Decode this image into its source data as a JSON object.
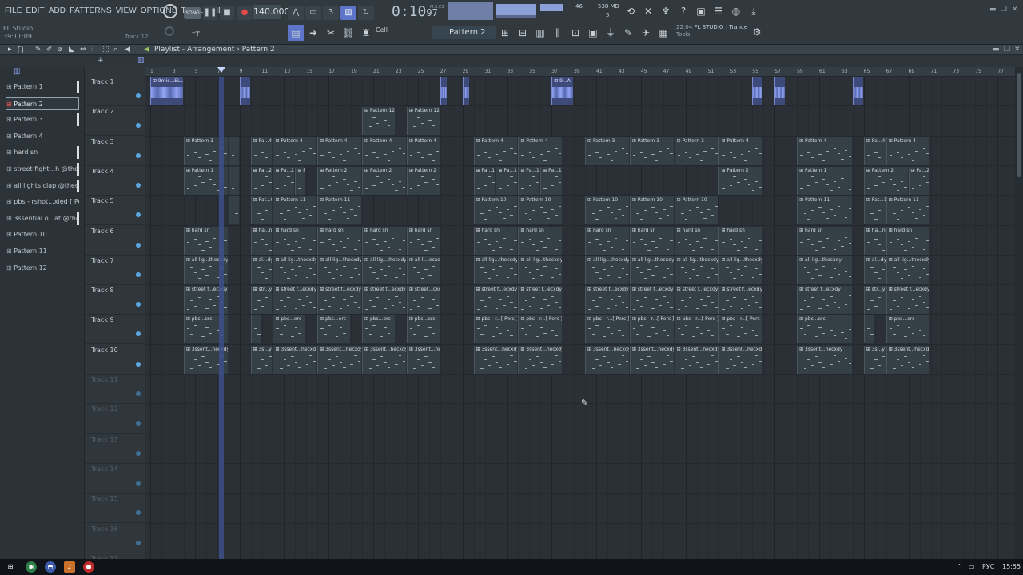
{
  "menu": [
    "FILE",
    "EDIT",
    "ADD",
    "PATTERNS",
    "VIEW",
    "OPTIONS",
    "TOOLS",
    "HELP"
  ],
  "hint": {
    "line1": "FL Studio",
    "line2": "39:11:09"
  },
  "pattern_label": "Track 12",
  "transport": {
    "mode": "SONG",
    "tempo": "140.000",
    "time": "0:10",
    "time_frac": "97",
    "time_unit": "M:S:CS"
  },
  "cpu": {
    "value": "46",
    "memory": "538 MB",
    "voices": "5"
  },
  "toolbar2": {
    "snap": "Cell",
    "pattern": "Pattern 2"
  },
  "news": {
    "time": "22:04",
    "text": "FL STUDIO | Trance",
    "sub": "Tools"
  },
  "playlist": {
    "breadcrumb": "Playlist - Arrangement",
    "sep": "›",
    "current_pattern": "Pattern 2"
  },
  "picker": [
    {
      "label": "Pattern 1",
      "bar": true
    },
    {
      "label": "Pattern 2",
      "bar": false,
      "selected": true
    },
    {
      "label": "Pattern 3",
      "bar": true
    },
    {
      "label": "Pattern 4",
      "bar": false
    },
    {
      "label": "hard sn",
      "bar": true
    },
    {
      "label": "street fight...h @thecxdy",
      "bar": true
    },
    {
      "label": "all lights clap @thecxdy",
      "bar": true
    },
    {
      "label": "pbs - rshot...xied [ Perc ]",
      "bar": false
    },
    {
      "label": "3ssential o...at @thecxdy",
      "bar": true
    },
    {
      "label": "Pattern 10",
      "bar": false
    },
    {
      "label": "Pattern 11",
      "bar": false
    },
    {
      "label": "Pattern 12",
      "bar": false
    }
  ],
  "tracks": [
    {
      "name": "Track 1",
      "active": true,
      "lvl": "none"
    },
    {
      "name": "Track 2",
      "active": true,
      "lvl": "none"
    },
    {
      "name": "Track 3",
      "active": true,
      "lvl": "gray"
    },
    {
      "name": "Track 4",
      "active": true,
      "lvl": "gray"
    },
    {
      "name": "Track 5",
      "active": true,
      "lvl": "none"
    },
    {
      "name": "Track 6",
      "active": true,
      "lvl": "white"
    },
    {
      "name": "Track 7",
      "active": true,
      "lvl": "white"
    },
    {
      "name": "Track 8",
      "active": true,
      "lvl": "white"
    },
    {
      "name": "Track 9",
      "active": true,
      "lvl": "none"
    },
    {
      "name": "Track 10",
      "active": true,
      "lvl": "white"
    },
    {
      "name": "Track 11",
      "active": false,
      "lvl": "none"
    },
    {
      "name": "Track 12",
      "active": false,
      "lvl": "none"
    },
    {
      "name": "Track 13",
      "active": false,
      "lvl": "none"
    },
    {
      "name": "Track 14",
      "active": false,
      "lvl": "none"
    },
    {
      "name": "Track 15",
      "active": false,
      "lvl": "none"
    },
    {
      "name": "Track 16",
      "active": false,
      "lvl": "none"
    },
    {
      "name": "Track 17",
      "active": false,
      "lvl": "none"
    }
  ],
  "ruler": [
    "1",
    "3",
    "5",
    "7",
    "9",
    "11",
    "13",
    "15",
    "17",
    "19",
    "21",
    "23",
    "25",
    "27",
    "29",
    "31",
    "33",
    "35",
    "37",
    "39",
    "41",
    "43",
    "45",
    "47",
    "49",
    "51",
    "53",
    "55",
    "57",
    "59",
    "61",
    "63",
    "65",
    "67",
    "69",
    "71",
    "73",
    "75",
    "77"
  ],
  "clips": [
    {
      "t": 0,
      "type": "audio",
      "start": 1,
      "len": 3,
      "label": "9mic...ELLA"
    },
    {
      "t": 0,
      "type": "audio",
      "start": 9,
      "len": 1,
      "label": ""
    },
    {
      "t": 0,
      "type": "audio",
      "start": 27,
      "len": 0.7,
      "label": ""
    },
    {
      "t": 0,
      "type": "audio",
      "start": 29,
      "len": 0.7,
      "label": ""
    },
    {
      "t": 0,
      "type": "audio",
      "start": 37,
      "len": 2,
      "label": "9...A"
    },
    {
      "t": 0,
      "type": "audio",
      "start": 55,
      "len": 1,
      "label": ""
    },
    {
      "t": 0,
      "type": "audio",
      "start": 57,
      "len": 1,
      "label": ""
    },
    {
      "t": 0,
      "type": "audio",
      "start": 64,
      "len": 1,
      "label": ""
    },
    {
      "t": 1,
      "type": "pat",
      "start": 20,
      "len": 3,
      "label": "Pattern 12"
    },
    {
      "t": 1,
      "type": "pat",
      "start": 24,
      "len": 3,
      "label": "Pattern 12"
    },
    {
      "t": 2,
      "type": "pat",
      "start": 4,
      "len": 4,
      "label": "Pattern 3"
    },
    {
      "t": 2,
      "type": "pat",
      "start": 8,
      "len": 1,
      "label": ""
    },
    {
      "t": 2,
      "type": "pat",
      "start": 10,
      "len": 2,
      "label": "Pa...4"
    },
    {
      "t": 2,
      "type": "pat",
      "start": 12,
      "len": 4,
      "label": "Pattern 4"
    },
    {
      "t": 2,
      "type": "pat",
      "start": 16,
      "len": 4,
      "label": "Pattern 4"
    },
    {
      "t": 2,
      "type": "pat",
      "start": 20,
      "len": 4,
      "label": "Pattern 4"
    },
    {
      "t": 2,
      "type": "pat",
      "start": 24,
      "len": 3,
      "label": "Pattern 4"
    },
    {
      "t": 2,
      "type": "pat",
      "start": 30,
      "len": 4,
      "label": "Pattern 4"
    },
    {
      "t": 2,
      "type": "pat",
      "start": 34,
      "len": 4,
      "label": "Pattern 4"
    },
    {
      "t": 2,
      "type": "pat",
      "start": 40,
      "len": 4,
      "label": "Pattern 3"
    },
    {
      "t": 2,
      "type": "pat",
      "start": 44,
      "len": 4,
      "label": "Pattern 3"
    },
    {
      "t": 2,
      "type": "pat",
      "start": 48,
      "len": 4,
      "label": "Pattern 3"
    },
    {
      "t": 2,
      "type": "pat",
      "start": 52,
      "len": 4,
      "label": "Pattern 4"
    },
    {
      "t": 2,
      "type": "pat",
      "start": 59,
      "len": 5,
      "label": "Pattern 4"
    },
    {
      "t": 2,
      "type": "pat",
      "start": 65,
      "len": 2,
      "label": "Pa...4"
    },
    {
      "t": 2,
      "type": "pat",
      "start": 67,
      "len": 4,
      "label": "Pattern 4"
    },
    {
      "t": 3,
      "type": "pat",
      "start": 4,
      "len": 4,
      "label": "Pattern 1"
    },
    {
      "t": 3,
      "type": "pat",
      "start": 8,
      "len": 1,
      "label": ""
    },
    {
      "t": 3,
      "type": "pat",
      "start": 10,
      "len": 2,
      "label": "Pa...2"
    },
    {
      "t": 3,
      "type": "pat",
      "start": 12,
      "len": 2,
      "label": "Pa...2"
    },
    {
      "t": 3,
      "type": "pat",
      "start": 14,
      "len": 1,
      "label": "Pa...1"
    },
    {
      "t": 3,
      "type": "pat",
      "start": 16,
      "len": 4,
      "label": "Pattern 2"
    },
    {
      "t": 3,
      "type": "pat",
      "start": 20,
      "len": 4,
      "label": "Pattern 2"
    },
    {
      "t": 3,
      "type": "pat",
      "start": 24,
      "len": 3,
      "label": "Pattern 2"
    },
    {
      "t": 3,
      "type": "pat",
      "start": 30,
      "len": 2,
      "label": "Pa...1"
    },
    {
      "t": 3,
      "type": "pat",
      "start": 32,
      "len": 2,
      "label": "Pa...1"
    },
    {
      "t": 3,
      "type": "pat",
      "start": 34,
      "len": 2,
      "label": "Pa...1"
    },
    {
      "t": 3,
      "type": "pat",
      "start": 36,
      "len": 2,
      "label": "Pa...1"
    },
    {
      "t": 3,
      "type": "pat",
      "start": 52,
      "len": 4,
      "label": "Pattern 2"
    },
    {
      "t": 3,
      "type": "pat",
      "start": 59,
      "len": 5,
      "label": "Pattern 1"
    },
    {
      "t": 3,
      "type": "pat",
      "start": 65,
      "len": 4,
      "label": "Pattern 2"
    },
    {
      "t": 3,
      "type": "pat",
      "start": 69,
      "len": 2,
      "label": "Pa...2"
    },
    {
      "t": 4,
      "type": "pat",
      "start": 8,
      "len": 1,
      "label": ""
    },
    {
      "t": 4,
      "type": "pat",
      "start": 10,
      "len": 2,
      "label": "Pat...0"
    },
    {
      "t": 4,
      "type": "pat",
      "start": 12,
      "len": 4,
      "label": "Pattern 11"
    },
    {
      "t": 4,
      "type": "pat",
      "start": 16,
      "len": 4,
      "label": "Pattern 11"
    },
    {
      "t": 4,
      "type": "pat",
      "start": 30,
      "len": 4,
      "label": "Pattern 10"
    },
    {
      "t": 4,
      "type": "pat",
      "start": 34,
      "len": 4,
      "label": "Pattern 10"
    },
    {
      "t": 4,
      "type": "pat",
      "start": 40,
      "len": 4,
      "label": "Pattern 10"
    },
    {
      "t": 4,
      "type": "pat",
      "start": 44,
      "len": 4,
      "label": "Pattern 10"
    },
    {
      "t": 4,
      "type": "pat",
      "start": 48,
      "len": 4,
      "label": "Pattern 10"
    },
    {
      "t": 4,
      "type": "pat",
      "start": 59,
      "len": 5,
      "label": "Pattern 11"
    },
    {
      "t": 4,
      "type": "pat",
      "start": 65,
      "len": 2,
      "label": "Pat...1"
    },
    {
      "t": 4,
      "type": "pat",
      "start": 67,
      "len": 4,
      "label": "Pattern 11"
    },
    {
      "t": 5,
      "type": "pat",
      "start": 4,
      "len": 4,
      "label": "hard sn"
    },
    {
      "t": 5,
      "type": "pat",
      "start": 10,
      "len": 2,
      "label": "ha...n"
    },
    {
      "t": 5,
      "type": "pat",
      "start": 12,
      "len": 4,
      "label": "hard sn"
    },
    {
      "t": 5,
      "type": "pat",
      "start": 16,
      "len": 4,
      "label": "hard sn"
    },
    {
      "t": 5,
      "type": "pat",
      "start": 20,
      "len": 4,
      "label": "hard sn"
    },
    {
      "t": 5,
      "type": "pat",
      "start": 24,
      "len": 3,
      "label": "hard sn"
    },
    {
      "t": 5,
      "type": "pat",
      "start": 30,
      "len": 4,
      "label": "hard sn"
    },
    {
      "t": 5,
      "type": "pat",
      "start": 34,
      "len": 4,
      "label": "hard sn"
    },
    {
      "t": 5,
      "type": "pat",
      "start": 40,
      "len": 4,
      "label": "hard sn"
    },
    {
      "t": 5,
      "type": "pat",
      "start": 44,
      "len": 4,
      "label": "hard sn"
    },
    {
      "t": 5,
      "type": "pat",
      "start": 48,
      "len": 4,
      "label": "hard sn"
    },
    {
      "t": 5,
      "type": "pat",
      "start": 52,
      "len": 4,
      "label": "hard sn"
    },
    {
      "t": 5,
      "type": "pat",
      "start": 59,
      "len": 5,
      "label": "hard sn"
    },
    {
      "t": 5,
      "type": "pat",
      "start": 65,
      "len": 2,
      "label": "ha...n"
    },
    {
      "t": 5,
      "type": "pat",
      "start": 67,
      "len": 4,
      "label": "hard sn"
    },
    {
      "t": 6,
      "type": "pat",
      "start": 4,
      "len": 4,
      "label": "all lig...thecxdy"
    },
    {
      "t": 6,
      "type": "pat",
      "start": 10,
      "len": 2,
      "label": "al...dy"
    },
    {
      "t": 6,
      "type": "pat",
      "start": 12,
      "len": 4,
      "label": "all lig...thecxdy"
    },
    {
      "t": 6,
      "type": "pat",
      "start": 16,
      "len": 4,
      "label": "all lig...thecxdy"
    },
    {
      "t": 6,
      "type": "pat",
      "start": 20,
      "len": 4,
      "label": "all lig...thecxdy"
    },
    {
      "t": 6,
      "type": "pat",
      "start": 24,
      "len": 3,
      "label": "all li...ecxdy"
    },
    {
      "t": 6,
      "type": "pat",
      "start": 30,
      "len": 4,
      "label": "all lig...thecxdy"
    },
    {
      "t": 6,
      "type": "pat",
      "start": 34,
      "len": 4,
      "label": "all lig...thecxdy"
    },
    {
      "t": 6,
      "type": "pat",
      "start": 40,
      "len": 4,
      "label": "all lig...thecxdy"
    },
    {
      "t": 6,
      "type": "pat",
      "start": 44,
      "len": 4,
      "label": "all lig...thecxdy"
    },
    {
      "t": 6,
      "type": "pat",
      "start": 48,
      "len": 4,
      "label": "all lig...thecxdy"
    },
    {
      "t": 6,
      "type": "pat",
      "start": 52,
      "len": 4,
      "label": "all lig...thecxdy"
    },
    {
      "t": 6,
      "type": "pat",
      "start": 59,
      "len": 5,
      "label": "all lig...thecxdy"
    },
    {
      "t": 6,
      "type": "pat",
      "start": 65,
      "len": 2,
      "label": "al...dy"
    },
    {
      "t": 6,
      "type": "pat",
      "start": 67,
      "len": 4,
      "label": "all lig...thecxdy"
    },
    {
      "t": 7,
      "type": "pat",
      "start": 4,
      "len": 4,
      "label": "street f...ecxdy"
    },
    {
      "t": 7,
      "type": "pat",
      "start": 10,
      "len": 2,
      "label": "str...y"
    },
    {
      "t": 7,
      "type": "pat",
      "start": 12,
      "len": 4,
      "label": "street f...ecxdy"
    },
    {
      "t": 7,
      "type": "pat",
      "start": 16,
      "len": 4,
      "label": "street f...ecxdy"
    },
    {
      "t": 7,
      "type": "pat",
      "start": 20,
      "len": 4,
      "label": "street f...ecxdy"
    },
    {
      "t": 7,
      "type": "pat",
      "start": 24,
      "len": 3,
      "label": "street...cxdy"
    },
    {
      "t": 7,
      "type": "pat",
      "start": 30,
      "len": 4,
      "label": "street f...ecxdy"
    },
    {
      "t": 7,
      "type": "pat",
      "start": 34,
      "len": 4,
      "label": "street f...ecxdy"
    },
    {
      "t": 7,
      "type": "pat",
      "start": 40,
      "len": 4,
      "label": "street f...ecxdy"
    },
    {
      "t": 7,
      "type": "pat",
      "start": 44,
      "len": 4,
      "label": "street f...ecxdy"
    },
    {
      "t": 7,
      "type": "pat",
      "start": 48,
      "len": 4,
      "label": "street f...ecxdy"
    },
    {
      "t": 7,
      "type": "pat",
      "start": 52,
      "len": 4,
      "label": "street f...ecxdy"
    },
    {
      "t": 7,
      "type": "pat",
      "start": 59,
      "len": 5,
      "label": "street f...ecxdy"
    },
    {
      "t": 7,
      "type": "pat",
      "start": 65,
      "len": 2,
      "label": "str...y"
    },
    {
      "t": 7,
      "type": "pat",
      "start": 67,
      "len": 4,
      "label": "street f...ecxdy"
    },
    {
      "t": 8,
      "type": "pat",
      "start": 4,
      "len": 4,
      "label": "pbs...erc"
    },
    {
      "t": 8,
      "type": "pat",
      "start": 10,
      "len": 1,
      "label": ""
    },
    {
      "t": 8,
      "type": "pat",
      "start": 12,
      "len": 3,
      "label": "pbs...erc"
    },
    {
      "t": 8,
      "type": "pat",
      "start": 16,
      "len": 3,
      "label": "pbs...erc"
    },
    {
      "t": 8,
      "type": "pat",
      "start": 20,
      "len": 3,
      "label": "pbs...erc"
    },
    {
      "t": 8,
      "type": "pat",
      "start": 24,
      "len": 3,
      "label": "pbs...erc"
    },
    {
      "t": 8,
      "type": "pat",
      "start": 30,
      "len": 4,
      "label": "pbs - r...[ Perc ]"
    },
    {
      "t": 8,
      "type": "pat",
      "start": 34,
      "len": 4,
      "label": "pbs - r...[ Perc ]"
    },
    {
      "t": 8,
      "type": "pat",
      "start": 40,
      "len": 4,
      "label": "pbs - r...[ Perc ]"
    },
    {
      "t": 8,
      "type": "pat",
      "start": 44,
      "len": 4,
      "label": "pbs - r...[ Perc ]"
    },
    {
      "t": 8,
      "type": "pat",
      "start": 48,
      "len": 4,
      "label": "pbs - r...[ Perc ]"
    },
    {
      "t": 8,
      "type": "pat",
      "start": 52,
      "len": 4,
      "label": "pbs - r...[ Perc ]"
    },
    {
      "t": 8,
      "type": "pat",
      "start": 59,
      "len": 5,
      "label": "pbs...erc"
    },
    {
      "t": 8,
      "type": "pat",
      "start": 65,
      "len": 1,
      "label": ""
    },
    {
      "t": 8,
      "type": "pat",
      "start": 67,
      "len": 4,
      "label": "pbs...erc"
    },
    {
      "t": 9,
      "type": "pat",
      "start": 4,
      "len": 4,
      "label": "3ssent...hecxdy"
    },
    {
      "t": 9,
      "type": "pat",
      "start": 10,
      "len": 2,
      "label": "3s...y"
    },
    {
      "t": 9,
      "type": "pat",
      "start": 12,
      "len": 4,
      "label": "3ssent...hecxdy"
    },
    {
      "t": 9,
      "type": "pat",
      "start": 16,
      "len": 4,
      "label": "3ssent...hecxdy"
    },
    {
      "t": 9,
      "type": "pat",
      "start": 20,
      "len": 4,
      "label": "3ssent...hecxdy"
    },
    {
      "t": 9,
      "type": "pat",
      "start": 24,
      "len": 3,
      "label": "3ssent...hecxdy"
    },
    {
      "t": 9,
      "type": "pat",
      "start": 30,
      "len": 4,
      "label": "3ssent...hecxdy"
    },
    {
      "t": 9,
      "type": "pat",
      "start": 34,
      "len": 4,
      "label": "3ssent...hecxdy"
    },
    {
      "t": 9,
      "type": "pat",
      "start": 40,
      "len": 4,
      "label": "3ssent...hecxdy"
    },
    {
      "t": 9,
      "type": "pat",
      "start": 44,
      "len": 4,
      "label": "3ssent...hecxdy"
    },
    {
      "t": 9,
      "type": "pat",
      "start": 48,
      "len": 4,
      "label": "3ssent...hecxdy"
    },
    {
      "t": 9,
      "type": "pat",
      "start": 52,
      "len": 4,
      "label": "3ssent...hecxdy"
    },
    {
      "t": 9,
      "type": "pat",
      "start": 59,
      "len": 5,
      "label": "3ssent...hecxdy"
    },
    {
      "t": 9,
      "type": "pat",
      "start": 65,
      "len": 2,
      "label": "3s...y"
    },
    {
      "t": 9,
      "type": "pat",
      "start": 67,
      "len": 4,
      "label": "3ssent...hecxdy"
    }
  ],
  "taskbar": {
    "lang": "РУС",
    "clock": "15:55"
  }
}
